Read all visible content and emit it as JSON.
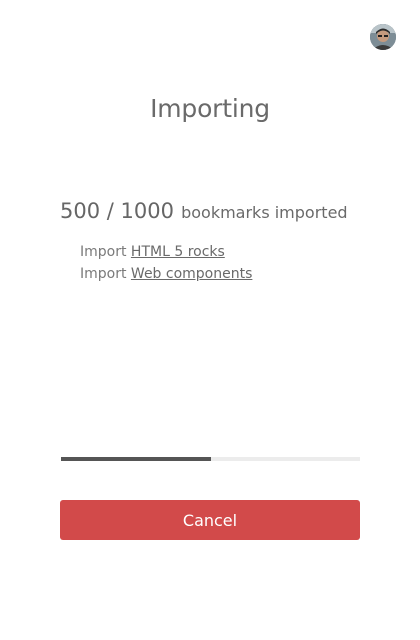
{
  "header": {
    "title": "Importing",
    "avatar_alt": "user avatar"
  },
  "status": {
    "imported": "500",
    "separator": " / ",
    "total": "1000",
    "suffix": "bookmarks imported",
    "progress_fraction": 0.5
  },
  "imports": [
    {
      "prefix": "Import",
      "link": "HTML 5 rocks"
    },
    {
      "prefix": "Import",
      "link": "Web components"
    }
  ],
  "actions": {
    "cancel_label": "Cancel",
    "cancel_color": "#d24a4a"
  }
}
